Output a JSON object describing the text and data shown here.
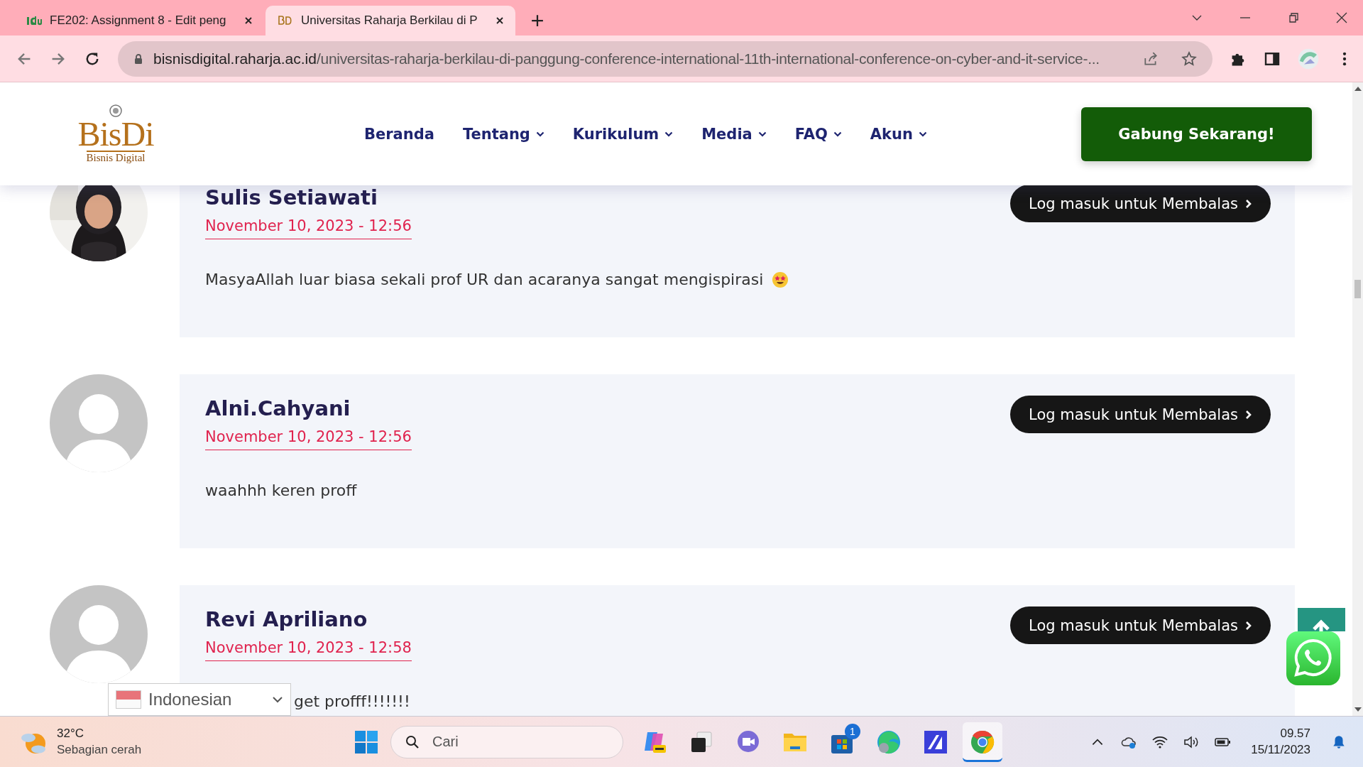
{
  "browser": {
    "tabs": [
      {
        "title": "FE202: Assignment 8 - Edit peng",
        "kind": "idu",
        "selected": false
      },
      {
        "title": "Universitas Raharja Berkilau di P",
        "kind": "bisdi",
        "selected": true
      }
    ],
    "url_domain": "bisnisdigital.raharja.ac.id",
    "url_path": "/universitas-raharja-berkilau-di-panggung-conference-international-11th-international-conference-on-cyber-and-it-service-..."
  },
  "site": {
    "logo": {
      "title": "BisDi",
      "subtitle": "Bisnis Digital"
    },
    "nav": [
      {
        "label": "Beranda",
        "dropdown": false
      },
      {
        "label": "Tentang",
        "dropdown": true
      },
      {
        "label": "Kurikulum",
        "dropdown": true
      },
      {
        "label": "Media",
        "dropdown": true
      },
      {
        "label": "FAQ",
        "dropdown": true
      },
      {
        "label": "Akun",
        "dropdown": true
      }
    ],
    "cta": "Gabung Sekarang!"
  },
  "comments": [
    {
      "author": "Sulis Setiawati",
      "date": "November 10, 2023 - 12:56",
      "text": "MasyaAllah luar biasa sekali prof UR dan acaranya sangat mengispirasi",
      "emoji": true,
      "covered": false,
      "reply": "Log masuk untuk Membalas"
    },
    {
      "author": "Alni.Cahyani",
      "date": "November 10, 2023 - 12:56",
      "text": "waahhh keren proff",
      "emoji": false,
      "kind": "default",
      "covered": false,
      "reply": "Log masuk untuk Membalas"
    },
    {
      "author": "Revi Apriliano",
      "date": "November 10, 2023 - 12:58",
      "text": "get profff!!!!!!!",
      "emoji": false,
      "kind": "default",
      "covered": true,
      "reply": "Log masuk untuk Membalas"
    }
  ],
  "language_selector": {
    "value": "Indonesian"
  },
  "taskbar": {
    "weather": {
      "temp": "32°C",
      "condition": "Sebagian cerah"
    },
    "search": {
      "placeholder": "Cari"
    },
    "apps": [
      {
        "kind": "copilot",
        "selected": false
      },
      {
        "kind": "taskview",
        "selected": false
      },
      {
        "kind": "chat",
        "selected": false
      },
      {
        "kind": "folder",
        "selected": false
      },
      {
        "kind": "store",
        "selected": false,
        "badge": "1"
      },
      {
        "kind": "edge",
        "selected": false
      },
      {
        "kind": "editor",
        "selected": false
      },
      {
        "kind": "chrome",
        "selected": true
      }
    ],
    "time": "09.57",
    "date": "15/11/2023"
  }
}
